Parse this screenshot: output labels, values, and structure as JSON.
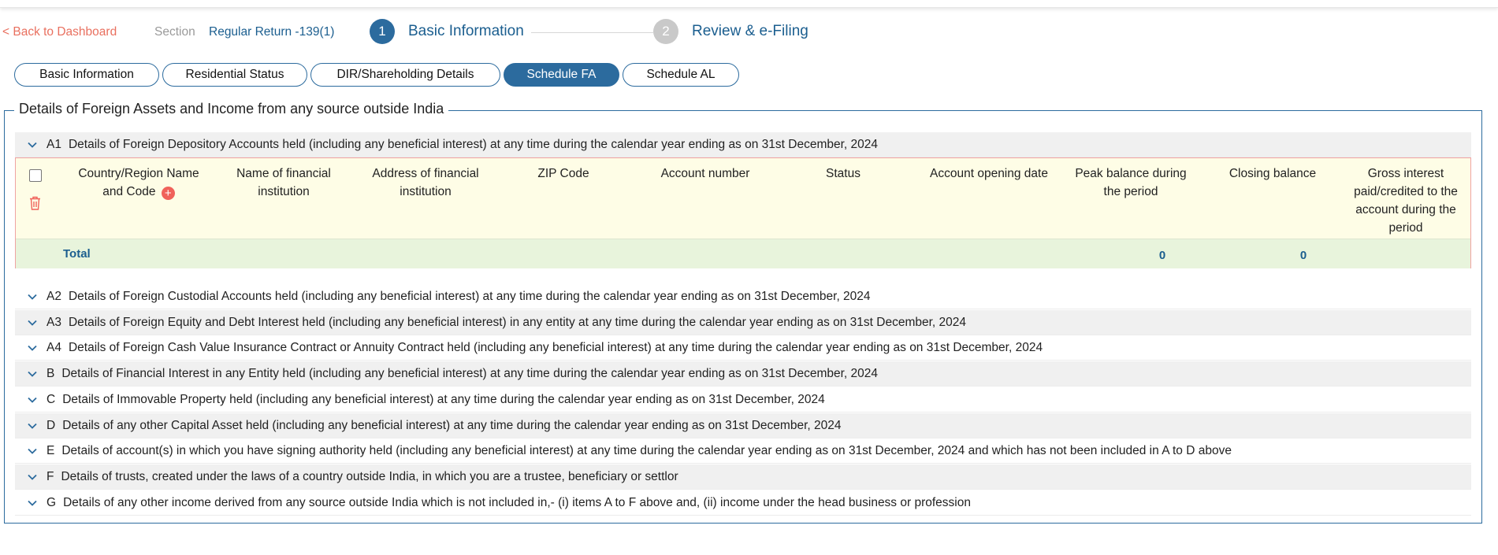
{
  "header": {
    "back_label": "< Back to Dashboard",
    "section_label": "Section",
    "section_value": "Regular Return -139(1)",
    "steps": [
      {
        "number": "1",
        "label": "Basic Information"
      },
      {
        "number": "2",
        "label": "Review & e-Filing"
      }
    ]
  },
  "tabs": [
    {
      "label": "Basic Information"
    },
    {
      "label": "Residential Status"
    },
    {
      "label": "DIR/Shareholding Details"
    },
    {
      "label": "Schedule FA"
    },
    {
      "label": "Schedule AL"
    }
  ],
  "main": {
    "title": "Details of Foreign Assets and Income from any source outside India",
    "sections": [
      {
        "code": "A1",
        "label": "Details of Foreign Depository Accounts held (including any beneficial interest) at any time during the calendar year ending as on 31st December, 2024"
      },
      {
        "code": "A2",
        "label": "Details of Foreign Custodial Accounts held (including any beneficial interest) at any time during the calendar year ending as on 31st December, 2024"
      },
      {
        "code": "A3",
        "label": "Details of Foreign Equity and Debt Interest held (including any beneficial interest) in any entity at any time during the calendar year ending as on 31st December, 2024"
      },
      {
        "code": "A4",
        "label": "Details of Foreign Cash Value Insurance Contract or Annuity Contract held (including any beneficial interest) at any time during the calendar year ending as on 31st December, 2024"
      },
      {
        "code": "B",
        "label": "Details of Financial Interest in any Entity held (including any beneficial interest) at any time during the calendar year ending as on 31st December, 2024"
      },
      {
        "code": "C",
        "label": "Details of Immovable Property held (including any beneficial interest) at any time during the calendar year ending as on 31st December, 2024"
      },
      {
        "code": "D",
        "label": "Details of any other Capital Asset held (including any beneficial interest) at any time during the calendar year ending as on 31st December, 2024"
      },
      {
        "code": "E",
        "label": "Details of account(s) in which you have signing authority held (including any beneficial interest) at any time during the calendar year ending as on 31st December, 2024 and which has not been included in A to D above"
      },
      {
        "code": "F",
        "label": "Details of trusts, created under the laws of a country outside India, in which you are a trustee, beneficiary or settlor"
      },
      {
        "code": "G",
        "label": "Details of any other income derived from any source outside India which is not included in,- (i) items A to F above and, (ii) income under the head business or profession"
      }
    ],
    "a1_table": {
      "columns": [
        {
          "lines": [
            "Country/Region Name",
            "and Code"
          ]
        },
        {
          "lines": [
            "Name of financial",
            "institution"
          ]
        },
        {
          "lines": [
            "Address of financial",
            "institution"
          ]
        },
        {
          "lines": [
            "ZIP Code"
          ]
        },
        {
          "lines": [
            "Account number"
          ]
        },
        {
          "lines": [
            "Status"
          ]
        },
        {
          "lines": [
            "Account opening date"
          ]
        },
        {
          "lines": [
            "Peak balance during",
            "the period"
          ]
        },
        {
          "lines": [
            "Closing balance"
          ]
        },
        {
          "lines": [
            "Gross interest",
            "paid/credited to the",
            "account during the",
            "period"
          ]
        }
      ],
      "total_label": "Total",
      "total_peak_balance": "0",
      "total_closing_balance": "0"
    }
  },
  "colors": {
    "primary": "#2c6b9e",
    "link_text": "#1b5e8f",
    "back_link": "#e9705f",
    "table_bg": "#fefde6",
    "total_bg": "#e8f4dc",
    "alert": "#f0625a"
  },
  "icons": {
    "chevron": "chevron-down-icon",
    "trash": "trash-icon",
    "add": "plus-circle-icon"
  }
}
